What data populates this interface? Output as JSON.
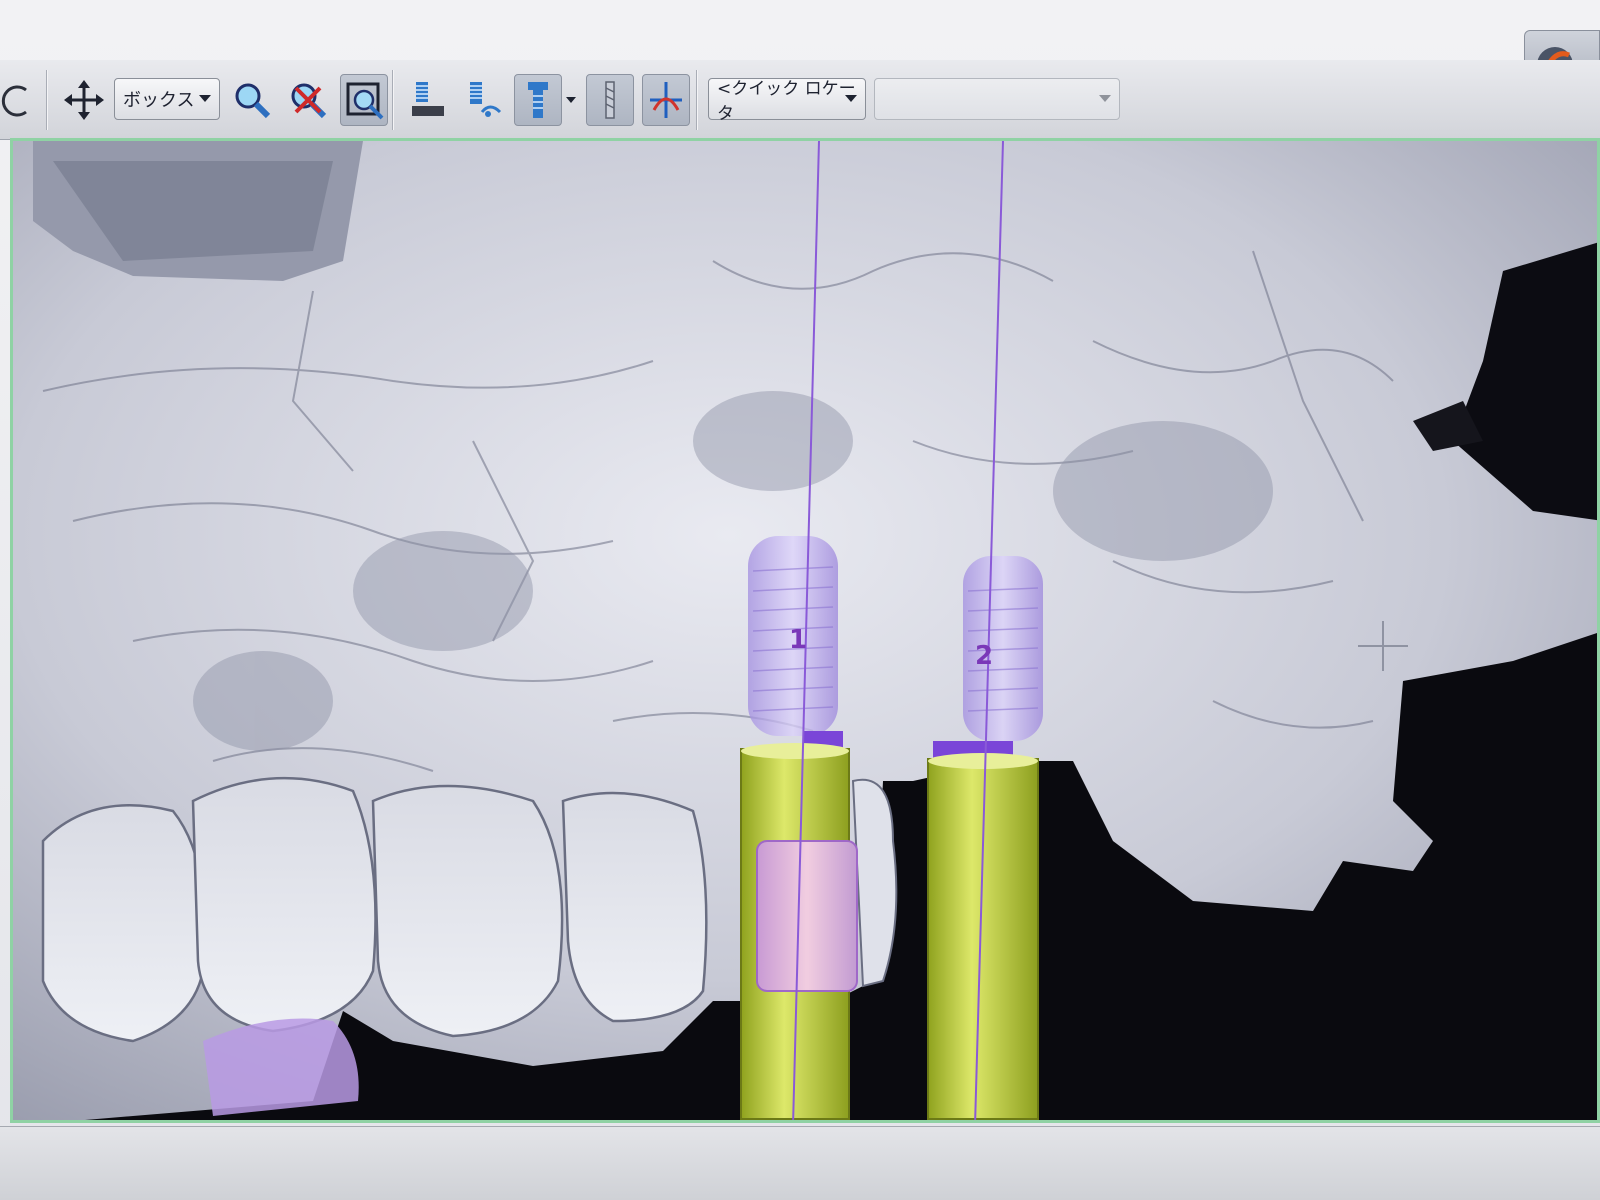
{
  "toolbar": {
    "view_mode": "ボックス",
    "quick_locator": "<クイック ロケータ",
    "quick_locator_value": ""
  },
  "implants": [
    {
      "number": "1"
    },
    {
      "number": "2"
    }
  ],
  "colors": {
    "bone": "#c9cbd6",
    "implant": "#b5a7e6",
    "sleeve": "#c4d538",
    "axis": "#8a5ad8",
    "viewport_border": "#8fd2a4"
  }
}
